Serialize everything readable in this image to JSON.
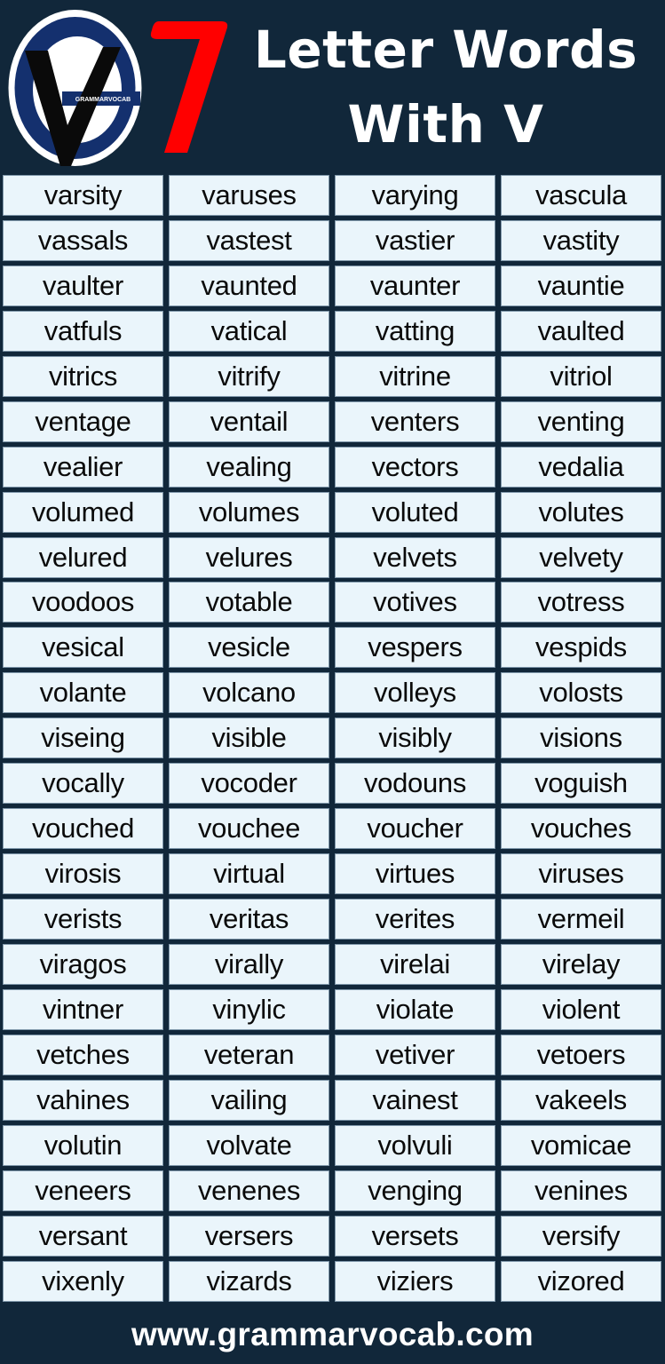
{
  "header": {
    "logo_text": "GRAMMARVOCAB",
    "number": "7",
    "title_line1": "Letter Words",
    "title_line2": "With V"
  },
  "colors": {
    "background": "#11273a",
    "accent_number": "#ff0000",
    "logo_blue": "#14306e",
    "cell_fill": "#eaf5fb",
    "text_dark": "#0a0a0a",
    "text_light": "#ffffff"
  },
  "words": [
    [
      "varsity",
      "varuses",
      "varying",
      "vascula"
    ],
    [
      "vassals",
      "vastest",
      "vastier",
      "vastity"
    ],
    [
      "vaulter",
      "vaunted",
      "vaunter",
      "vauntie"
    ],
    [
      "vatfuls",
      "vatical",
      "vatting",
      "vaulted"
    ],
    [
      "vitrics",
      "vitrify",
      "vitrine",
      "vitriol"
    ],
    [
      "ventage",
      "ventail",
      "venters",
      "venting"
    ],
    [
      "vealier",
      "vealing",
      "vectors",
      "vedalia"
    ],
    [
      "volumed",
      "volumes",
      "voluted",
      "volutes"
    ],
    [
      "velured",
      "velures",
      "velvets",
      "velvety"
    ],
    [
      "voodoos",
      "votable",
      "votives",
      "votress"
    ],
    [
      "vesical",
      "vesicle",
      "vespers",
      "vespids"
    ],
    [
      "volante",
      "volcano",
      "volleys",
      "volosts"
    ],
    [
      "viseing",
      "visible",
      "visibly",
      "visions"
    ],
    [
      "vocally",
      "vocoder",
      "vodouns",
      "voguish"
    ],
    [
      "vouched",
      "vouchee",
      "voucher",
      "vouches"
    ],
    [
      "virosis",
      "virtual",
      "virtues",
      "viruses"
    ],
    [
      "verists",
      "veritas",
      "verites",
      "vermeil"
    ],
    [
      "viragos",
      "virally",
      "virelai",
      "virelay"
    ],
    [
      "vintner",
      "vinylic",
      "violate",
      "violent"
    ],
    [
      "vetches",
      "veteran",
      "vetiver",
      "vetoers"
    ],
    [
      "vahines",
      "vailing",
      "vainest",
      "vakeels"
    ],
    [
      "volutin",
      "volvate",
      "volvuli",
      "vomicae"
    ],
    [
      "veneers",
      "venenes",
      "venging",
      "venines"
    ],
    [
      "versant",
      "versers",
      "versets",
      "versify"
    ],
    [
      "vixenly",
      "vizards",
      "viziers",
      "vizored"
    ]
  ],
  "footer": {
    "url": "www.grammarvocab.com"
  }
}
